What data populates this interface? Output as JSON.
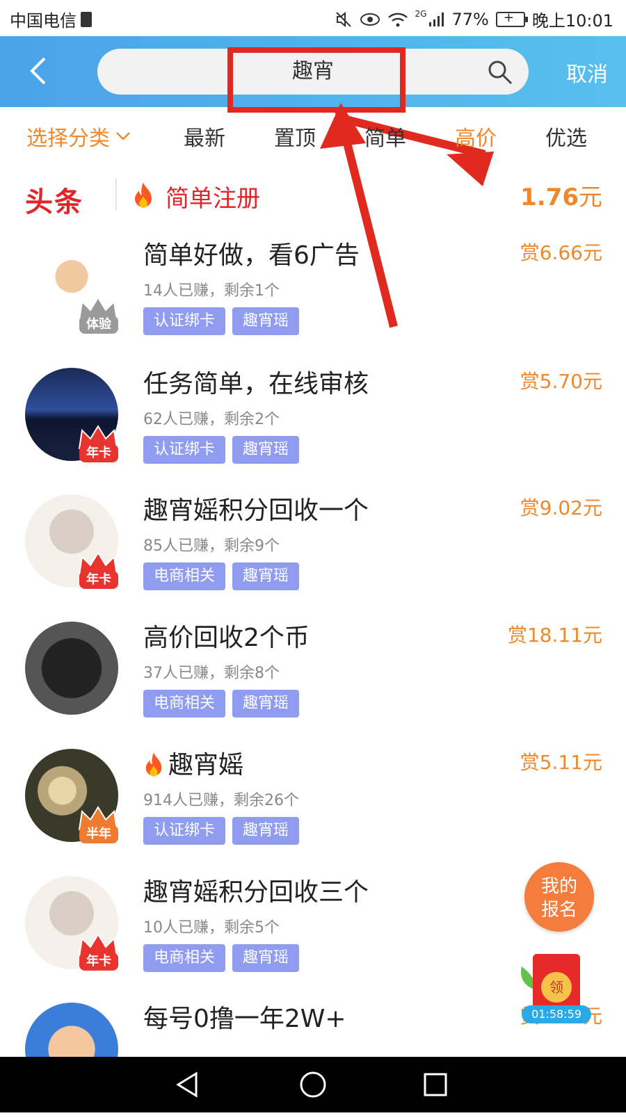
{
  "status_bar": {
    "carrier": "中国电信",
    "signal_type": "2G",
    "battery": "77%",
    "time": "晚上10:01"
  },
  "search": {
    "query": "趣宵",
    "cancel_label": "取消"
  },
  "filters": {
    "category_label": "选择分类",
    "tabs": [
      {
        "label": "最新",
        "active": false
      },
      {
        "label": "置顶",
        "active": false
      },
      {
        "label": "简单",
        "active": false
      },
      {
        "label": "高价",
        "active": true
      },
      {
        "label": "优选",
        "active": false
      }
    ]
  },
  "headline": {
    "tag": "头条",
    "title": "简单注册",
    "price_value": "1.76",
    "price_unit": "元"
  },
  "tasks": [
    {
      "title": "简单好做，看6广告",
      "meta": "14人已赚，剩余1个",
      "tags": [
        "认证绑卡",
        "趣宵瑶"
      ],
      "reward": "赏6.66元",
      "badge": "体验",
      "hot": false
    },
    {
      "title": "任务简单，在线审核",
      "meta": "62人已赚，剩余2个",
      "tags": [
        "认证绑卡",
        "趣宵瑶"
      ],
      "reward": "赏5.70元",
      "badge": "年卡",
      "hot": false
    },
    {
      "title": "趣宵媱积分回收一个",
      "meta": "85人已赚，剩余9个",
      "tags": [
        "电商相关",
        "趣宵瑶"
      ],
      "reward": "赏9.02元",
      "badge": "年卡",
      "hot": false
    },
    {
      "title": "高价回收2个币",
      "meta": "37人已赚，剩余8个",
      "tags": [
        "电商相关",
        "趣宵瑶"
      ],
      "reward": "赏18.11元",
      "badge": "",
      "hot": false
    },
    {
      "title": "趣宵媱",
      "meta": "914人已赚，剩余26个",
      "tags": [
        "认证绑卡",
        "趣宵瑶"
      ],
      "reward": "赏5.11元",
      "badge": "半年",
      "hot": true
    },
    {
      "title": "趣宵媱积分回收三个",
      "meta": "10人已赚，剩余5个",
      "tags": [
        "电商相关",
        "趣宵瑶"
      ],
      "reward": "",
      "badge": "年卡",
      "hot": false
    },
    {
      "title": "每号0撸一年2W+",
      "meta": "",
      "tags": [],
      "reward": "赏5.28元",
      "badge": "",
      "hot": false
    }
  ],
  "floating": {
    "mine_line1": "我的",
    "mine_line2": "报名",
    "redpack_seal": "领",
    "redpack_timer": "01:58:59"
  },
  "colors": {
    "accent_orange": "#f0872b",
    "header_blue": "#4ba3e8",
    "tag_purple": "#8f9cf0",
    "headline_red": "#e0262b",
    "annotation_red": "#e02a1f"
  }
}
